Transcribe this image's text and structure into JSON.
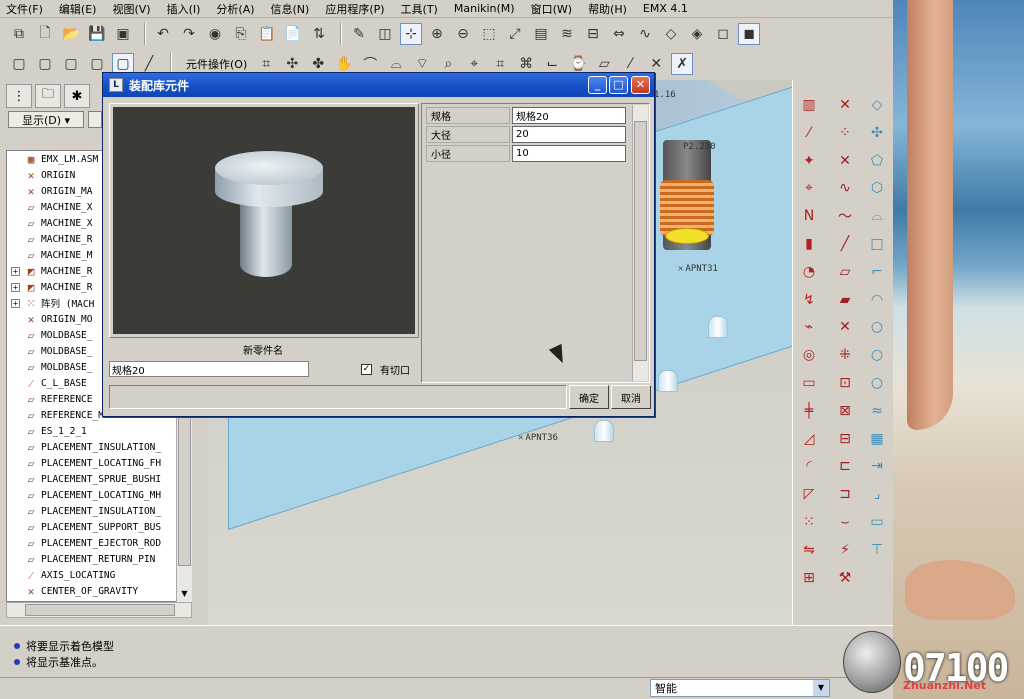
{
  "menu": [
    "文件(F)",
    "编辑(E)",
    "视图(V)",
    "插入(I)",
    "分析(A)",
    "信息(N)",
    "应用程序(P)",
    "工具(T)",
    "Manikin(M)",
    "窗口(W)",
    "帮助(H)",
    "EMX 4.1"
  ],
  "toolbar2_label": "元件操作(O)",
  "left_panel": {
    "show_button": "显示(D) ▾",
    "tree": [
      {
        "label": "EMX_LM.ASM",
        "icon": "assembly-icon",
        "expand": ""
      },
      {
        "label": "ORIGIN",
        "icon": "csys-icon",
        "expand": ""
      },
      {
        "label": "ORIGIN_MA",
        "icon": "csys-icon",
        "expand": ""
      },
      {
        "label": "MACHINE_X",
        "icon": "datum-plane-icon",
        "expand": ""
      },
      {
        "label": "MACHINE_X",
        "icon": "datum-plane-icon",
        "expand": ""
      },
      {
        "label": "MACHINE_R",
        "icon": "datum-plane-icon",
        "expand": ""
      },
      {
        "label": "MACHINE_M",
        "icon": "datum-plane-icon",
        "expand": ""
      },
      {
        "label": "MACHINE_R",
        "icon": "part-icon",
        "expand": "+"
      },
      {
        "label": "MACHINE_R",
        "icon": "part-icon",
        "expand": "+"
      },
      {
        "label": "阵列 (MACH",
        "icon": "pattern-icon",
        "expand": "+"
      },
      {
        "label": "ORIGIN_MO",
        "icon": "csys-icon",
        "expand": ""
      },
      {
        "label": "MOLDBASE_",
        "icon": "datum-plane-icon",
        "expand": ""
      },
      {
        "label": "MOLDBASE_",
        "icon": "datum-plane-icon",
        "expand": ""
      },
      {
        "label": "MOLDBASE_",
        "icon": "datum-plane-icon",
        "expand": ""
      },
      {
        "label": "C_L_BASE",
        "icon": "axis-icon",
        "expand": ""
      },
      {
        "label": "REFERENCE",
        "icon": "datum-plane-icon",
        "expand": ""
      },
      {
        "label": "REFERENCE_MA",
        "icon": "datum-plane-icon",
        "expand": ""
      },
      {
        "label": "ES_1_2_1",
        "icon": "datum-plane-icon",
        "expand": ""
      },
      {
        "label": "PLACEMENT_INSULATION_",
        "icon": "datum-plane-icon",
        "expand": ""
      },
      {
        "label": "PLACEMENT_LOCATING_FH",
        "icon": "datum-plane-icon",
        "expand": ""
      },
      {
        "label": "PLACEMENT_SPRUE_BUSHI",
        "icon": "datum-plane-icon",
        "expand": ""
      },
      {
        "label": "PLACEMENT_LOCATING_MH",
        "icon": "datum-plane-icon",
        "expand": ""
      },
      {
        "label": "PLACEMENT_INSULATION_",
        "icon": "datum-plane-icon",
        "expand": ""
      },
      {
        "label": "PLACEMENT_SUPPORT_BUS",
        "icon": "datum-plane-icon",
        "expand": ""
      },
      {
        "label": "PLACEMENT_EJECTOR_ROD",
        "icon": "datum-plane-icon",
        "expand": ""
      },
      {
        "label": "PLACEMENT_RETURN_PIN",
        "icon": "datum-plane-icon",
        "expand": ""
      },
      {
        "label": "AXIS_LOCATING",
        "icon": "axis-icon",
        "expand": ""
      },
      {
        "label": "CENTER_OF_GRAVITY",
        "icon": "csys-icon",
        "expand": ""
      }
    ]
  },
  "graphics": {
    "labels": [
      "APNT31",
      "APNT36",
      "P2.230",
      "1.16"
    ]
  },
  "dialog": {
    "title": "装配库元件",
    "new_part_name_label": "新零件名",
    "name_value": "规格20",
    "checkbox_label": "有切口",
    "checkbox_checked": "✓",
    "params": [
      {
        "name": "规格",
        "value": "规格20"
      },
      {
        "name": "大径",
        "value": "20"
      },
      {
        "name": "小径",
        "value": "10"
      }
    ],
    "ok": "确定",
    "cancel": "取消",
    "bottom_value": ""
  },
  "status": {
    "messages": [
      "将要显示着色模型",
      "将显示基准点。"
    ],
    "filter": "智能"
  },
  "watermark": {
    "number": "07100",
    "url": "Zhuanzhi.Net"
  }
}
